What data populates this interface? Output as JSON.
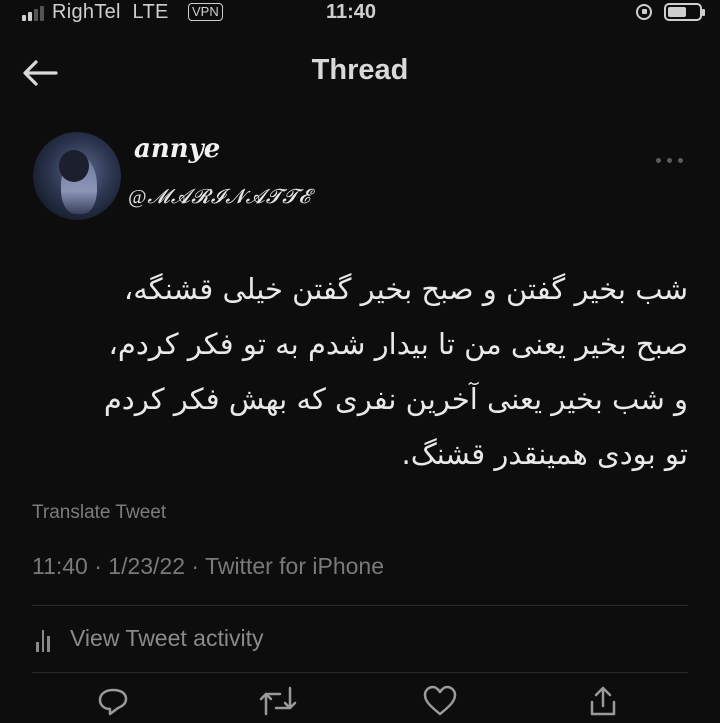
{
  "status_bar": {
    "carrier": "RighTel",
    "network": "LTE",
    "vpn": "VPN",
    "time": "11:40",
    "signal_bars_filled": 2,
    "signal_bars_total": 4
  },
  "header": {
    "title": "Thread"
  },
  "author": {
    "display_name": "annye",
    "handle": "@𝓜𝓐𝓡𝓘𝓝𝓐𝓣𝓣𝓔"
  },
  "tweet": {
    "text": "شب بخیر گفتن و صبح بخیر گفتن خیلی قشنگه،\nصبح بخیر یعنی من تا بیدار شدم به تو فکر کردم،\nو شب بخیر یعنی آخرین نفری که بهش فکر کردم\nتو بودی همینقدر قشنگ."
  },
  "translate_label": "Translate Tweet",
  "meta": "11:40 · 1/23/22 · Twitter for iPhone",
  "activity_label": "View Tweet activity",
  "icons": {
    "back": "arrow-left-icon",
    "more": "more-icon",
    "reply": "reply-icon",
    "retweet": "retweet-icon",
    "like": "heart-icon",
    "share": "share-icon"
  },
  "colors": {
    "background": "#0d0d0d",
    "text_primary": "#e9e9e9",
    "text_secondary": "#7a7a7a"
  }
}
